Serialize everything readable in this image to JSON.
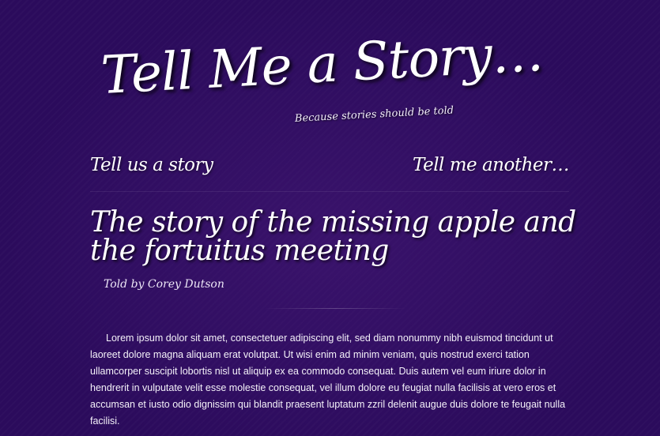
{
  "site": {
    "title": "Tell Me a Story…",
    "tagline": "Because stories should be told"
  },
  "nav": {
    "left_label": "Tell us a story",
    "right_label": "Tell me another…"
  },
  "story": {
    "title": "The story of the missing apple and the fortuitus meeting",
    "byline": "Told by Corey Dutson",
    "body": "Lorem ipsum dolor sit amet, consectetuer adipiscing elit, sed diam nonummy nibh euismod tincidunt ut laoreet dolore magna aliquam erat volutpat. Ut wisi enim ad minim veniam, quis nostrud exerci tation ullamcorper suscipit lobortis nisl ut aliquip ex ea commodo consequat. Duis autem vel eum iriure dolor in hendrerit in vulputate velit esse molestie consequat, vel illum dolore eu feugiat nulla facilisis at vero eros et accumsan et iusto odio dignissim qui blandit praesent luptatum zzril delenit augue duis dolore te feugait nulla facilisi."
  },
  "colors": {
    "background": "#2b0b5c",
    "text": "#ffffff"
  }
}
